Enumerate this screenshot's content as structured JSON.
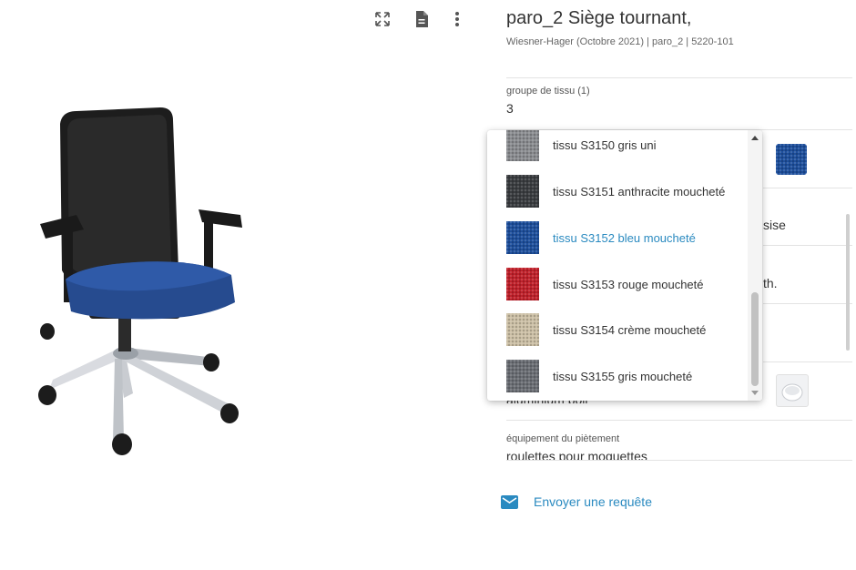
{
  "toolbar": {
    "icons": [
      "expand-icon",
      "document-icon",
      "more-vert-icon"
    ]
  },
  "product": {
    "title": "paro_2 Siège tournant,",
    "subtitle": "Wiesner-Hager (Octobre 2021) | paro_2 | 5220-101"
  },
  "fields": {
    "fabric_group_label": "groupe de tissu (1)",
    "fabric_group_value": "3",
    "partial_text_1": "sise",
    "partial_text_2": "th.",
    "partial_text_3": "aluminium poli",
    "base_equipment_label": "équipement du piètement",
    "base_equipment_value": "roulettes pour moquettes"
  },
  "dropdown": {
    "options": [
      {
        "label": "tissu S3150 gris uni",
        "color": "#8a8c90",
        "selected": false
      },
      {
        "label": "tissu S3151 anthracite moucheté",
        "color": "#3a3d40",
        "selected": false
      },
      {
        "label": "tissu S3152 bleu moucheté",
        "color": "#1e4f9c",
        "selected": true
      },
      {
        "label": "tissu S3153 rouge moucheté",
        "color": "#c0212b",
        "selected": false
      },
      {
        "label": "tissu S3154 crème moucheté",
        "color": "#cbbfa5",
        "selected": false
      },
      {
        "label": "tissu S3155 gris moucheté",
        "color": "#6b6e74",
        "selected": false
      }
    ]
  },
  "swatches": {
    "selected_color": "#1e4f9c"
  },
  "request": {
    "label": "Envoyer une requête"
  },
  "colors": {
    "accent": "#2a8ac0",
    "text": "#333333",
    "muted": "#666666"
  }
}
